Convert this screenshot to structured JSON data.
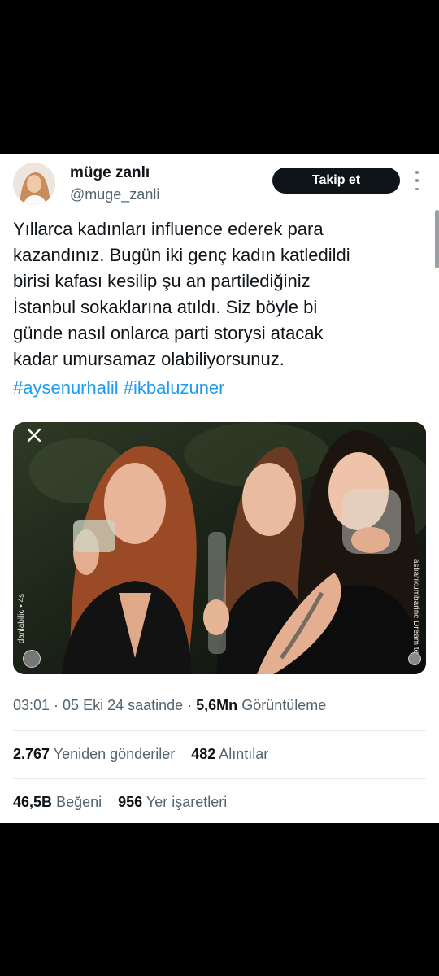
{
  "tweet": {
    "author_name": "müge zanlı",
    "author_handle": "@muge_zanli",
    "follow_label": "Takip et",
    "text": "Yıllarca kadınları influence ederek para\nkazandınız. Bugün iki genç kadın katledildi\nbirisi kafası kesilip şu an partilediğiniz\nİstanbul sokaklarına atıldı. Siz böyle bi\ngünde nasıl onlarca parti storysi atacak\nkadar umursamaz olabiliyorsunuz.",
    "hashtags": "#aysenurhalil #ikbaluzuner",
    "media": {
      "story_user": "danlabilic • 4s",
      "story_tag": "aslıarıkumbarinc Dream team"
    },
    "time": "03:01 · 05 Eki 24 saatinde ·",
    "views_count": "5,6Mn",
    "views_label": "Görüntüleme",
    "reposts_count": "2.767",
    "reposts_label": "Yeniden gönderiler",
    "quotes_count": "482",
    "quotes_label": "Alıntılar",
    "likes_count": "46,5B",
    "likes_label": "Beğeni",
    "bookmarks_count": "956",
    "bookmarks_label": "Yer işaretleri"
  },
  "icons": [
    "avatar",
    "more-vertical-icon",
    "close-icon"
  ],
  "colors": {
    "hashtag": "#1d9bf0",
    "button_bg": "#0f1419",
    "secondary_text": "#536471"
  }
}
